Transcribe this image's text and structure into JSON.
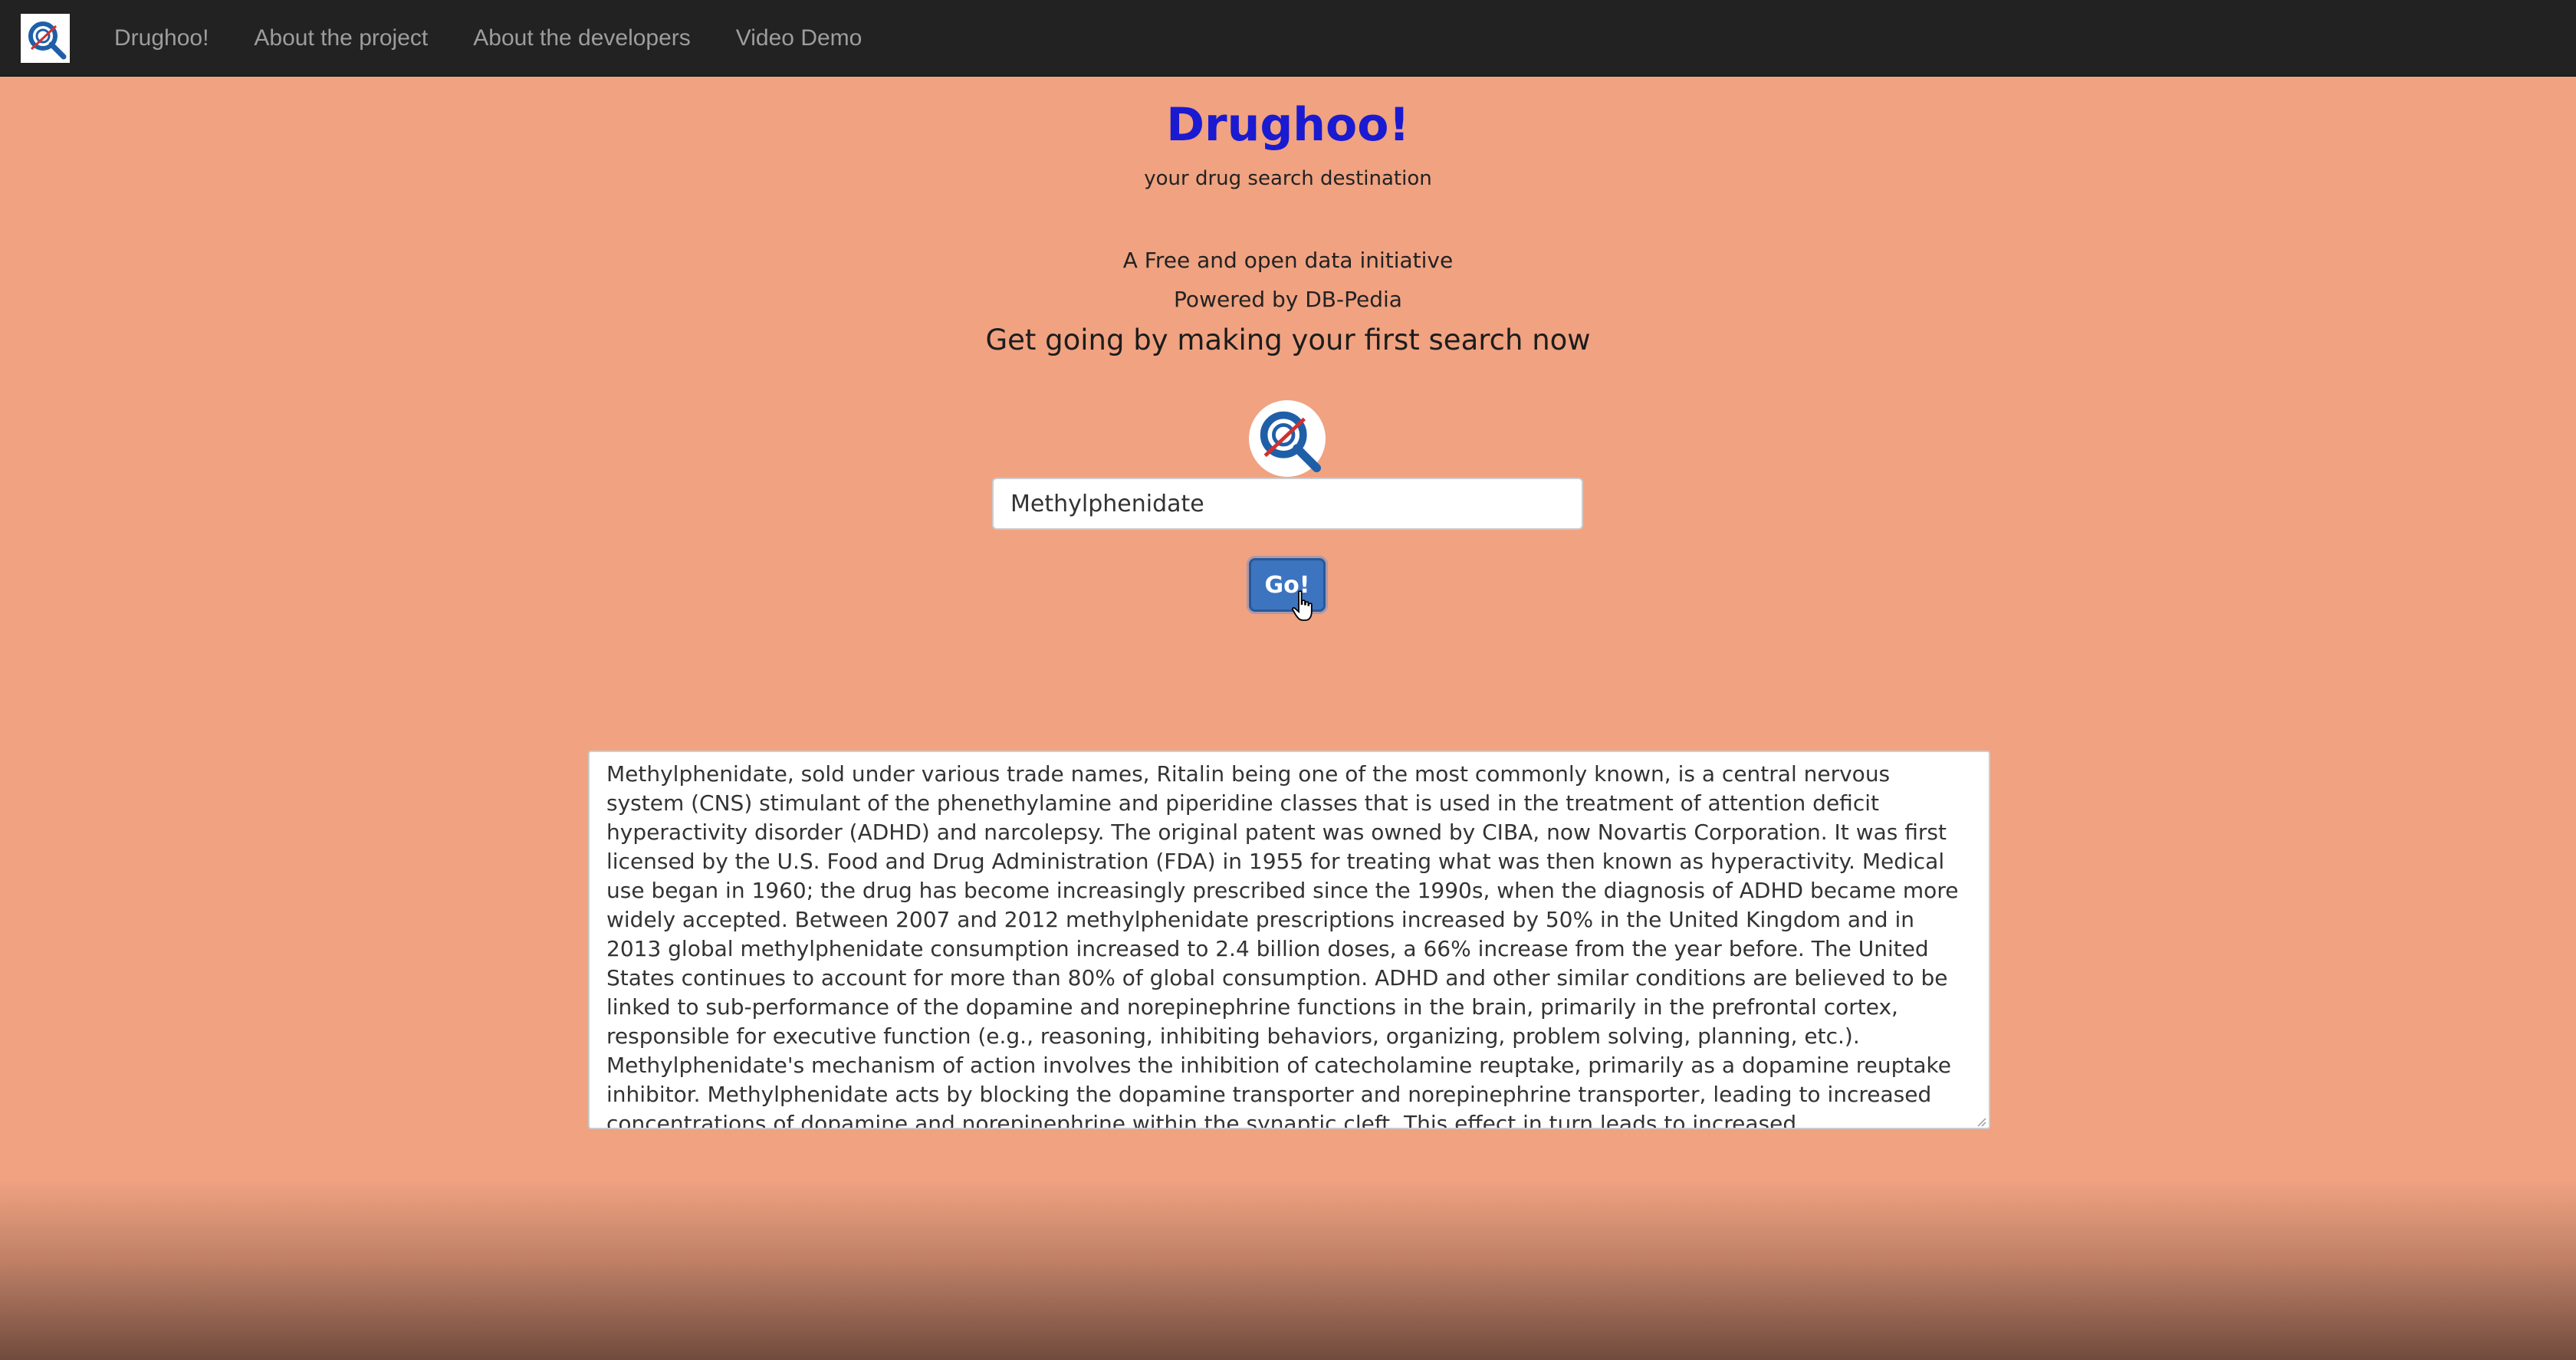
{
  "navbar": {
    "logo_icon": "drughoo-logo-icon",
    "items": [
      {
        "label": "Drughoo!"
      },
      {
        "label": "About the project"
      },
      {
        "label": "About the developers"
      },
      {
        "label": "Video Demo"
      }
    ]
  },
  "header": {
    "title": "Drughoo!",
    "subtitle": "your drug search destination",
    "tagline_1": "A Free and open data initiative",
    "tagline_2": "Powered by DB-Pedia",
    "cta": "Get going by making your first search now"
  },
  "search": {
    "logo_icon": "drughoo-logo-icon",
    "value": "Methylphenidate",
    "button_label": "Go!"
  },
  "result": {
    "text": "Methylphenidate, sold under various trade names, Ritalin being one of the most commonly known, is a central nervous system (CNS) stimulant of the phenethylamine and piperidine classes that is used in the treatment of attention deficit hyperactivity disorder (ADHD) and narcolepsy. The original patent was owned by CIBA, now Novartis Corporation. It was first licensed by the U.S. Food and Drug Administration (FDA) in 1955 for treating what was then known as hyperactivity. Medical use began in 1960; the drug has become increasingly prescribed since the 1990s, when the diagnosis of ADHD became more widely accepted. Between 2007 and 2012 methylphenidate prescriptions increased by 50% in the United Kingdom and in 2013 global methylphenidate consumption increased to 2.4 billion doses, a 66% increase from the year before. The United States continues to account for more than 80% of global consumption. ADHD and other similar conditions are believed to be linked to sub-performance of the dopamine and norepinephrine functions in the brain, primarily in the prefrontal cortex, responsible for executive function (e.g., reasoning, inhibiting behaviors, organizing, problem solving, planning, etc.). Methylphenidate's mechanism of action involves the inhibition of catecholamine reuptake, primarily as a dopamine reuptake inhibitor. Methylphenidate acts by blocking the dopamine transporter and norepinephrine transporter, leading to increased concentrations of dopamine and norepinephrine within the synaptic cleft. This effect in turn leads to increased neurotransmission of dopamine"
  },
  "colors": {
    "page_background": "#f0a281",
    "navbar_background": "#222222",
    "title_color": "#1a1ad0",
    "button_color": "#3d74c0"
  }
}
